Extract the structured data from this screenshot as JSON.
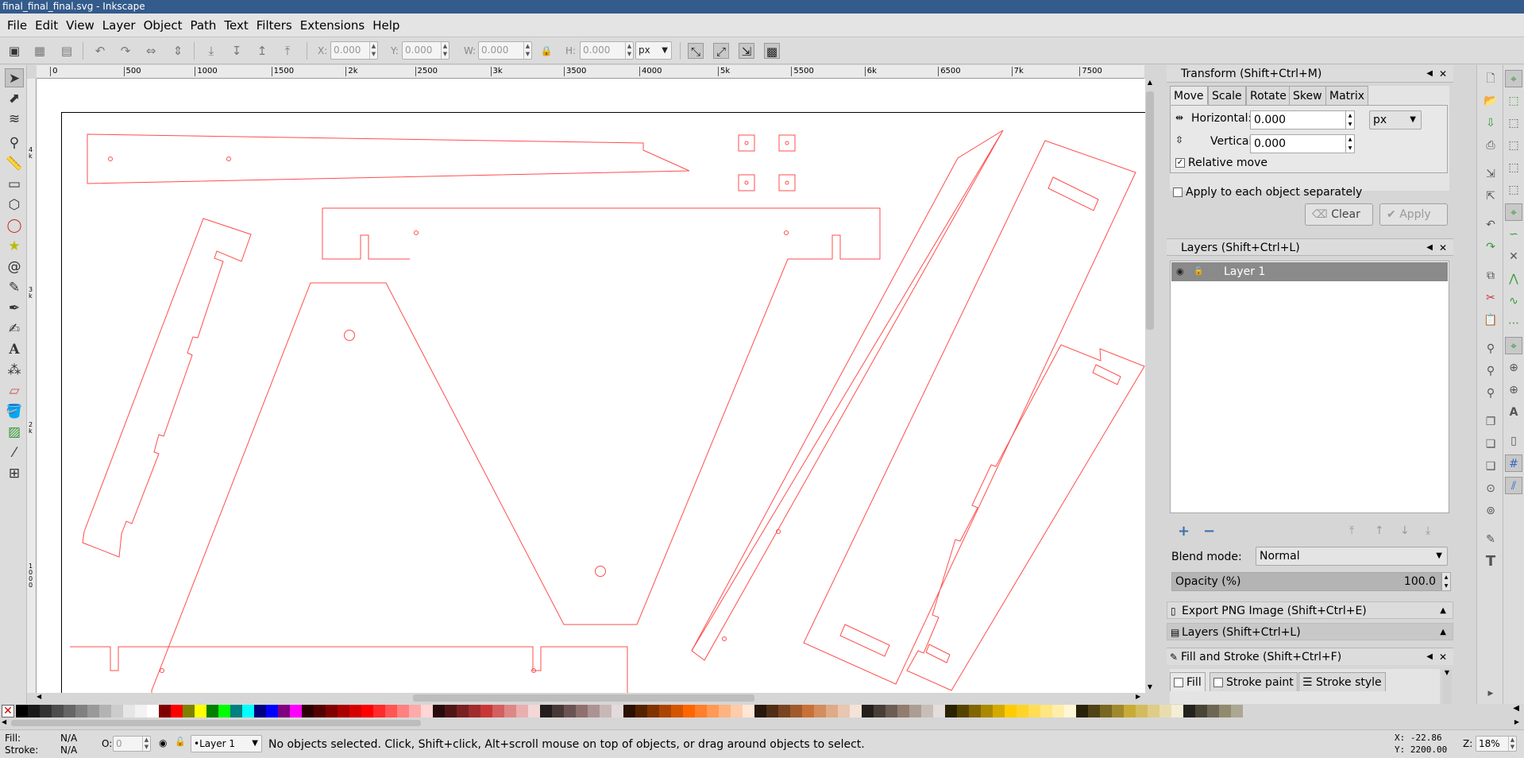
{
  "window": {
    "title": "final_final_final.svg - Inkscape"
  },
  "menu": [
    "File",
    "Edit",
    "View",
    "Layer",
    "Object",
    "Path",
    "Text",
    "Filters",
    "Extensions",
    "Help"
  ],
  "toolbar": {
    "x_label": "X:",
    "x_value": "0.000",
    "y_label": "Y:",
    "y_value": "0.000",
    "w_label": "W:",
    "w_value": "0.000",
    "h_label": "H:",
    "h_value": "0.000",
    "unit": "px"
  },
  "ruler_top": [
    "0",
    "500",
    "1000",
    "1500",
    "2k",
    "2500",
    "3k",
    "3500",
    "4000",
    "5k",
    "5500",
    "6k",
    "6500",
    "7k",
    "7500"
  ],
  "ruler_left": [
    "4 k",
    "3 k",
    "2 k",
    "1 0 0 0"
  ],
  "transform": {
    "title": "Transform (Shift+Ctrl+M)",
    "tabs": [
      "Move",
      "Scale",
      "Rotate",
      "Skew",
      "Matrix"
    ],
    "horizontal_label": "Horizontal:",
    "horizontal_value": "0.000",
    "vertical_label": "Vertical:",
    "vertical_value": "0.000",
    "unit": "px",
    "relative_move": "Relative move",
    "apply_each": "Apply to each object separately",
    "clear": "Clear",
    "apply": "Apply"
  },
  "layers": {
    "title": "Layers (Shift+Ctrl+L)",
    "items": [
      "Layer 1"
    ],
    "blend_label": "Blend mode:",
    "blend_value": "Normal",
    "opacity_label": "Opacity (%)",
    "opacity_value": "100.0"
  },
  "collapsed": {
    "export": "Export PNG Image (Shift+Ctrl+E)",
    "layers": "Layers (Shift+Ctrl+L)"
  },
  "fill_stroke": {
    "title": "Fill and Stroke (Shift+Ctrl+F)",
    "tabs": [
      "Fill",
      "Stroke paint",
      "Stroke style"
    ]
  },
  "status": {
    "fill_label": "Fill:",
    "fill_value": "N/A",
    "stroke_label": "Stroke:",
    "stroke_value": "N/A",
    "opacity_label": "O:",
    "opacity_value": "0",
    "layer": "•Layer 1",
    "message": "No objects selected. Click, Shift+click, Alt+scroll mouse on top of objects, or drag around objects to select.",
    "x_coord": "X:  -22.86",
    "y_coord": "Y: 2200.00",
    "zoom_label": "Z:",
    "zoom_value": "18%"
  },
  "palette_colors": [
    "#000000",
    "#1a1a1a",
    "#333333",
    "#4d4d4d",
    "#666666",
    "#808080",
    "#999999",
    "#b3b3b3",
    "#cccccc",
    "#e6e6e6",
    "#f2f2f2",
    "#ffffff",
    "#800000",
    "#ff0000",
    "#808000",
    "#ffff00",
    "#008000",
    "#00ff00",
    "#008080",
    "#00ffff",
    "#000080",
    "#0000ff",
    "#800080",
    "#ff00ff",
    "#2b0000",
    "#550000",
    "#800000",
    "#aa0000",
    "#d40000",
    "#ff0000",
    "#ff2a2a",
    "#ff5555",
    "#ff8080",
    "#ffaaaa",
    "#ffd5d5",
    "#280b0b",
    "#501616",
    "#782121",
    "#a02c2c",
    "#c83737",
    "#d35f5f",
    "#de8787",
    "#e9afaf",
    "#f4d7d7",
    "#241c1c",
    "#483737",
    "#6c5353",
    "#916f6f",
    "#ac9393",
    "#c8b7b7",
    "#e3dbdb",
    "#2b1100",
    "#552200",
    "#803300",
    "#aa4400",
    "#d45500",
    "#ff6600",
    "#ff7f2a",
    "#ff9955",
    "#ffb380",
    "#ffccaa",
    "#ffe6d5",
    "#28170b",
    "#502d16",
    "#784421",
    "#a05a2c",
    "#c87137",
    "#d38d5f",
    "#deaa87",
    "#e9c6af",
    "#f4e3d7",
    "#241f1c",
    "#483e37",
    "#6c5d53",
    "#917c6f",
    "#ac9d93",
    "#c8beb7",
    "#e3dedb",
    "#2b2200",
    "#554400",
    "#806600",
    "#aa8800",
    "#d4aa00",
    "#ffcc00",
    "#ffd42a",
    "#ffdd55",
    "#ffe680",
    "#ffeeaa",
    "#fff6d5",
    "#28220b",
    "#504416",
    "#786721",
    "#a0892c",
    "#c8ab37",
    "#d3bc5f",
    "#decd87",
    "#e9ddaf",
    "#f4eed7",
    "#24221c",
    "#484537",
    "#6c6753",
    "#918a6f",
    "#aca793"
  ]
}
